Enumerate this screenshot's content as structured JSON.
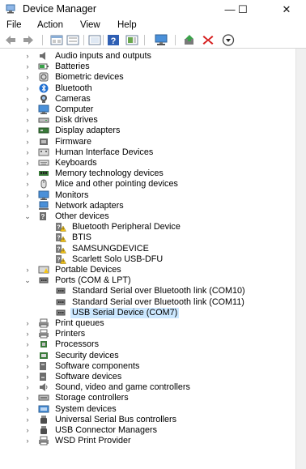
{
  "window": {
    "title": "Device Manager"
  },
  "window_controls": {
    "minimize": "—",
    "maximize": "☐",
    "close": "✕"
  },
  "menu": [
    "File",
    "Action",
    "View",
    "Help"
  ],
  "toolbar": [
    "back-icon",
    "forward-icon",
    "properties-icon",
    "update-icon",
    "help-icon",
    "view-icon",
    "monitor-icon",
    "add-driver-icon",
    "uninstall-icon",
    "disable-icon"
  ],
  "accent": "#cce8ff",
  "tree": [
    {
      "label": "Audio inputs and outputs",
      "level": 1,
      "arrow": "›",
      "icon": "speaker-icon"
    },
    {
      "label": "Batteries",
      "level": 1,
      "arrow": "›",
      "icon": "battery-icon"
    },
    {
      "label": "Biometric devices",
      "level": 1,
      "arrow": "›",
      "icon": "fingerprint-icon"
    },
    {
      "label": "Bluetooth",
      "level": 1,
      "arrow": "›",
      "icon": "bluetooth-icon"
    },
    {
      "label": "Cameras",
      "level": 1,
      "arrow": "›",
      "icon": "camera-icon"
    },
    {
      "label": "Computer",
      "level": 1,
      "arrow": "›",
      "icon": "computer-icon"
    },
    {
      "label": "Disk drives",
      "level": 1,
      "arrow": "›",
      "icon": "disk-icon"
    },
    {
      "label": "Display adapters",
      "level": 1,
      "arrow": "›",
      "icon": "display-adapter-icon"
    },
    {
      "label": "Firmware",
      "level": 1,
      "arrow": "›",
      "icon": "firmware-icon"
    },
    {
      "label": "Human Interface Devices",
      "level": 1,
      "arrow": "›",
      "icon": "hid-icon"
    },
    {
      "label": "Keyboards",
      "level": 1,
      "arrow": "›",
      "icon": "keyboard-icon"
    },
    {
      "label": "Memory technology devices",
      "level": 1,
      "arrow": "›",
      "icon": "memory-icon"
    },
    {
      "label": "Mice and other pointing devices",
      "level": 1,
      "arrow": "›",
      "icon": "mouse-icon"
    },
    {
      "label": "Monitors",
      "level": 1,
      "arrow": "›",
      "icon": "monitor-icon"
    },
    {
      "label": "Network adapters",
      "level": 1,
      "arrow": "›",
      "icon": "network-icon"
    },
    {
      "label": "Other devices",
      "level": 1,
      "arrow": "⌄",
      "icon": "unknown-device-icon"
    },
    {
      "label": "Bluetooth Peripheral Device",
      "level": 2,
      "arrow": "",
      "icon": "unknown-device-warning-icon"
    },
    {
      "label": "BTIS",
      "level": 2,
      "arrow": "",
      "icon": "unknown-device-warning-icon"
    },
    {
      "label": "SAMSUNGDEVICE",
      "level": 2,
      "arrow": "",
      "icon": "unknown-device-warning-icon"
    },
    {
      "label": "Scarlett Solo USB-DFU",
      "level": 2,
      "arrow": "",
      "icon": "unknown-device-warning-icon"
    },
    {
      "label": "Portable Devices",
      "level": 1,
      "arrow": "›",
      "icon": "portable-device-icon"
    },
    {
      "label": "Ports (COM & LPT)",
      "level": 1,
      "arrow": "⌄",
      "icon": "port-icon"
    },
    {
      "label": "Standard Serial over Bluetooth link (COM10)",
      "level": 2,
      "arrow": "",
      "icon": "port-icon"
    },
    {
      "label": "Standard Serial over Bluetooth link (COM11)",
      "level": 2,
      "arrow": "",
      "icon": "port-icon"
    },
    {
      "label": "USB Serial Device (COM7)",
      "level": 2,
      "arrow": "",
      "icon": "port-icon",
      "selected": true
    },
    {
      "label": "Print queues",
      "level": 1,
      "arrow": "›",
      "icon": "printer-icon"
    },
    {
      "label": "Printers",
      "level": 1,
      "arrow": "›",
      "icon": "printer-icon"
    },
    {
      "label": "Processors",
      "level": 1,
      "arrow": "›",
      "icon": "processor-icon"
    },
    {
      "label": "Security devices",
      "level": 1,
      "arrow": "›",
      "icon": "security-icon"
    },
    {
      "label": "Software components",
      "level": 1,
      "arrow": "›",
      "icon": "software-component-icon"
    },
    {
      "label": "Software devices",
      "level": 1,
      "arrow": "›",
      "icon": "software-device-icon"
    },
    {
      "label": "Sound, video and game controllers",
      "level": 1,
      "arrow": "›",
      "icon": "sound-icon"
    },
    {
      "label": "Storage controllers",
      "level": 1,
      "arrow": "›",
      "icon": "storage-icon"
    },
    {
      "label": "System devices",
      "level": 1,
      "arrow": "›",
      "icon": "system-icon"
    },
    {
      "label": "Universal Serial Bus controllers",
      "level": 1,
      "arrow": "›",
      "icon": "usb-icon"
    },
    {
      "label": "USB Connector Managers",
      "level": 1,
      "arrow": "›",
      "icon": "usb-icon"
    },
    {
      "label": "WSD Print Provider",
      "level": 1,
      "arrow": "›",
      "icon": "printer-icon"
    }
  ]
}
